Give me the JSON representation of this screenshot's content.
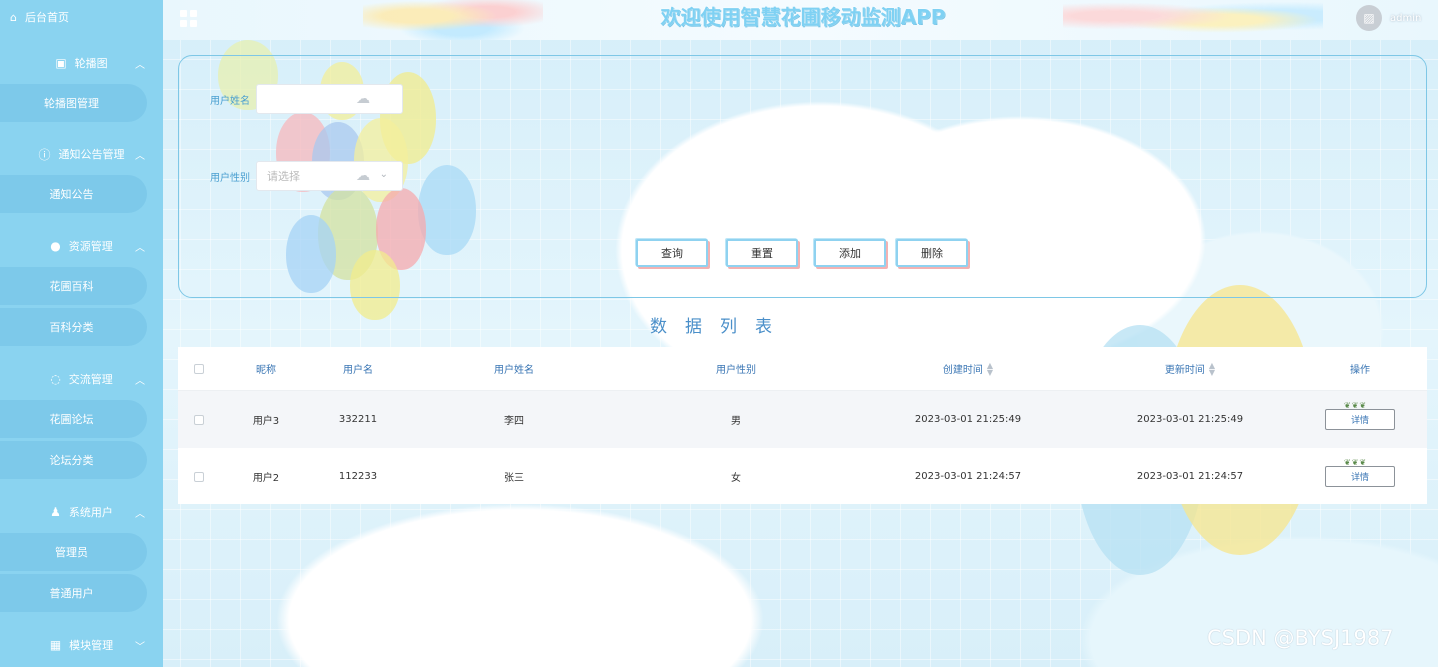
{
  "app": {
    "title": "欢迎使用智慧花圃移动监测APP",
    "user": "admin"
  },
  "sidebar": {
    "home_label": "后台首页",
    "groups": [
      {
        "title": "轮播图",
        "icon": "image-icon",
        "items": [
          "轮播图管理"
        ]
      },
      {
        "title": "通知公告管理",
        "icon": "info-icon",
        "items": [
          "通知公告"
        ]
      },
      {
        "title": "资源管理",
        "icon": "location-icon",
        "items": [
          "花圃百科",
          "百科分类"
        ]
      },
      {
        "title": "交流管理",
        "icon": "chat-icon",
        "items": [
          "花圃论坛",
          "论坛分类"
        ]
      },
      {
        "title": "系统用户",
        "icon": "user-icon",
        "items": [
          "管理员",
          "普通用户"
        ]
      },
      {
        "title": "模块管理",
        "icon": "grid-icon",
        "items": []
      }
    ]
  },
  "search": {
    "username_label": "用户姓名",
    "username_value": "",
    "gender_label": "用户性别",
    "gender_placeholder": "请选择",
    "buttons": {
      "query": "查询",
      "reset": "重置",
      "add": "添加",
      "delete": "删除"
    }
  },
  "list": {
    "title": "数据列表",
    "columns": [
      "昵称",
      "用户名",
      "用户姓名",
      "用户性别",
      "创建时间",
      "更新时间",
      "操作"
    ],
    "rows": [
      {
        "nickname": "用户3",
        "username": "332211",
        "realname": "李四",
        "gender": "男",
        "created": "2023-03-01 21:25:49",
        "updated": "2023-03-01 21:25:49",
        "action": "详情"
      },
      {
        "nickname": "用户2",
        "username": "112233",
        "realname": "张三",
        "gender": "女",
        "created": "2023-03-01 21:24:57",
        "updated": "2023-03-01 21:24:57",
        "action": "详情"
      }
    ]
  },
  "watermark": "CSDN @BYSJ1987",
  "colors": {
    "sidebar": "#8ad3f0",
    "sidebar_item": "#7dc9ea",
    "title_text": "#7fd1f3",
    "accent": "#4a8fc9"
  }
}
